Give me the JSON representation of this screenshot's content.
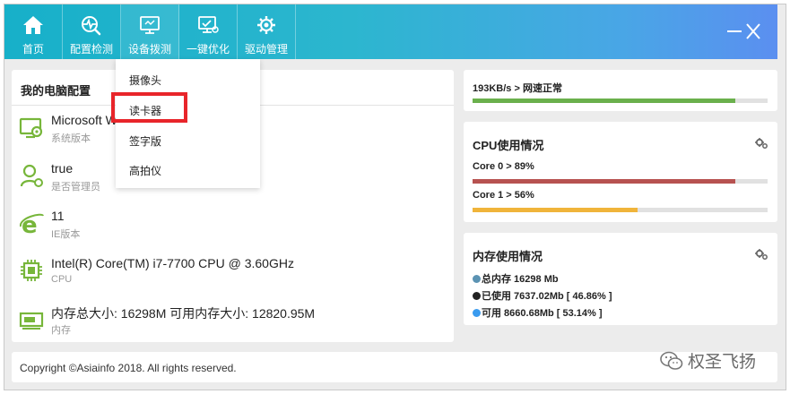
{
  "toolbar": {
    "items": [
      {
        "label": "首页",
        "icon": "home-icon"
      },
      {
        "label": "配置检测",
        "icon": "heartbeat-icon"
      },
      {
        "label": "设备拨测",
        "icon": "monitor-icon"
      },
      {
        "label": "一键优化",
        "icon": "optimize-icon"
      },
      {
        "label": "驱动管理",
        "icon": "driver-gear-icon"
      }
    ],
    "window_controls": [
      "minimize-icon",
      "close-icon"
    ]
  },
  "dropdown": {
    "items": [
      "摄像头",
      "读卡器",
      "签字版",
      "高拍仪"
    ],
    "highlighted": "读卡器"
  },
  "computer_config": {
    "title": "我的电脑配置",
    "rows": [
      {
        "value": "Microsoft W",
        "label": "系统版本",
        "icon": "system-settings-icon"
      },
      {
        "value": "true",
        "label": "是否管理员",
        "icon": "admin-user-icon"
      },
      {
        "value": "11",
        "label": "IE版本",
        "icon": "ie-browser-icon"
      },
      {
        "value": "Intel(R) Core(TM) i7-7700 CPU @ 3.60GHz",
        "label": "CPU",
        "icon": "cpu-chip-icon"
      },
      {
        "value": "内存总大小: 16298M 可用内存大小: 12820.95M",
        "label": "内存",
        "icon": "memory-icon"
      }
    ]
  },
  "network": {
    "text": "193KB/s > 网速正常",
    "level": 0.89,
    "color": "#6ab04c"
  },
  "cpu": {
    "title": "CPU使用情况",
    "cores": [
      {
        "label": "Core 0 > 89%",
        "percent": 89,
        "color": "#b75250"
      },
      {
        "label": "Core 1 > 56%",
        "percent": 56,
        "color": "#f0b43a"
      }
    ]
  },
  "memory": {
    "title": "内存使用情况",
    "lines": [
      {
        "text": "总内存 16298 Mb",
        "color": "#5b93b3"
      },
      {
        "text": "已使用 7637.02Mb [ 46.86% ]",
        "color": "#222222"
      },
      {
        "text": "可用 8660.68Mb [ 53.14% ]",
        "color": "#3a9bef"
      }
    ]
  },
  "footer": {
    "copyright": "Copyright ©Asiainfo 2018. All rights reserved."
  },
  "watermark": {
    "text": "权圣飞扬"
  }
}
